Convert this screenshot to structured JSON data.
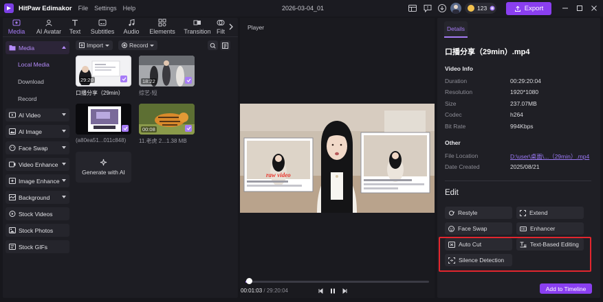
{
  "titlebar": {
    "app_name": "HitPaw Edimakor",
    "menu": [
      "File",
      "Settings",
      "Help"
    ],
    "doc_title": "2026-03-04_01",
    "credits": "123",
    "export_label": "Export"
  },
  "tabs": [
    {
      "label": "Media",
      "icon": "media-icon"
    },
    {
      "label": "AI Avatar",
      "icon": "ai-avatar-icon"
    },
    {
      "label": "Text",
      "icon": "text-icon"
    },
    {
      "label": "Subtitles",
      "icon": "subtitles-icon"
    },
    {
      "label": "Audio",
      "icon": "audio-icon"
    },
    {
      "label": "Elements",
      "icon": "elements-icon"
    },
    {
      "label": "Transition",
      "icon": "transition-icon"
    },
    {
      "label": "Filt",
      "icon": "filter-icon"
    }
  ],
  "sidebar": {
    "media": "Media",
    "media_sub": [
      "Local Media",
      "Download",
      "Record"
    ],
    "items": [
      "AI Video",
      "AI Image",
      "Face Swap",
      "Video Enhance",
      "Image Enhance",
      "Background",
      "Stock Videos",
      "Stock Photos",
      "Stock GIFs"
    ]
  },
  "library": {
    "import_label": "Import",
    "record_label": "Record",
    "generate_label": "Generate with AI",
    "items": [
      {
        "duration": "29:20",
        "name": "口播分享（29min）"
      },
      {
        "duration": "18:22",
        "name": "综艺-短"
      },
      {
        "duration": "",
        "name": "(a80ea51...011c848)"
      },
      {
        "duration": "00:08",
        "name": "11.老虎 2...1.38 MB"
      }
    ]
  },
  "player": {
    "title": "Player",
    "current_time": "00:01:03",
    "separator": "/",
    "total_time": "29:20:04",
    "progress": 0.02,
    "overlay_text": "raw video"
  },
  "details": {
    "tab": "Details",
    "file_name": "口播分享（29min）.mp4",
    "video_info_title": "Video Info",
    "video_info": [
      {
        "label": "Duration",
        "value": "00:29:20:04"
      },
      {
        "label": "Resolution",
        "value": "1920*1080"
      },
      {
        "label": "Size",
        "value": "237.07MB"
      },
      {
        "label": "Codec",
        "value": "h264"
      },
      {
        "label": "Bit Rate",
        "value": "994Kbps"
      }
    ],
    "other_title": "Other",
    "other": [
      {
        "label": "File Location",
        "value": "D:\\user\\桌面\\...（29min）.mp4"
      },
      {
        "label": "Date Created",
        "value": "2025/08/21"
      }
    ],
    "edit_title": "Edit",
    "edit_buttons": [
      "Restyle",
      "Extend",
      "Face Swap",
      "Enhancer",
      "Auto Cut",
      "Text-Based Editing",
      "Silence Detection"
    ],
    "add_to_timeline": "Add to Timeline"
  },
  "colors": {
    "accent": "#8a3ff0",
    "accent_text": "#a77cf7",
    "highlight": "#e3262e",
    "background": "#17171c"
  }
}
